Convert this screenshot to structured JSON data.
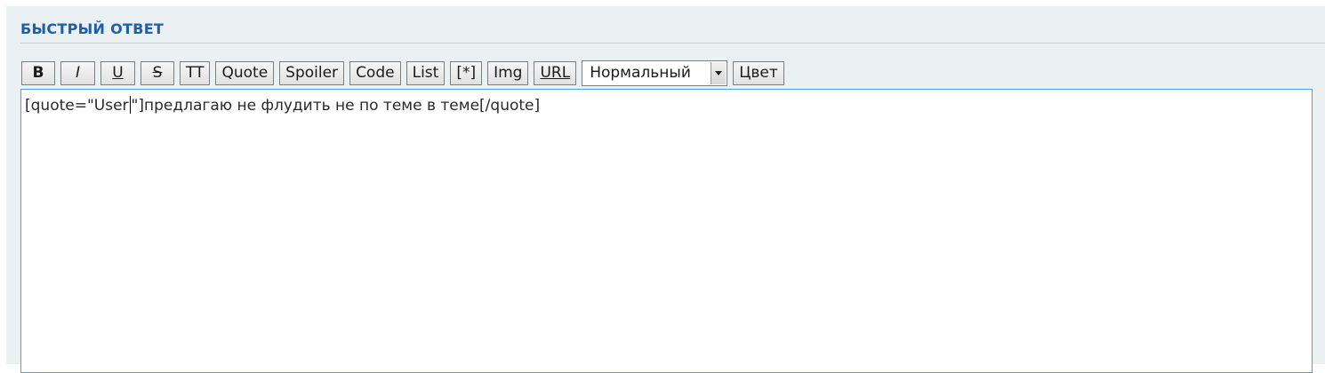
{
  "panel": {
    "title": "БЫСТРЫЙ ОТВЕТ"
  },
  "toolbar": {
    "bold_label": "B",
    "italic_label": "I",
    "underline_label": "U",
    "strike_label": "S",
    "tt_label": "TT",
    "quote_label": "Quote",
    "spoiler_label": "Spoiler",
    "code_label": "Code",
    "list_label": "List",
    "list_item_label": "[*]",
    "img_label": "Img",
    "url_label": "URL",
    "size_select": {
      "selected": "Нормальный"
    },
    "color_label": "Цвет"
  },
  "editor": {
    "text_before_caret": "[quote=\"User",
    "text_after_caret": "\"]предлагаю не флудить не по теме в теме[/quote]"
  },
  "colors": {
    "title": "#1f5fa5",
    "panel_bg": "#ebf0f2",
    "editor_border": "#4fa0da"
  }
}
